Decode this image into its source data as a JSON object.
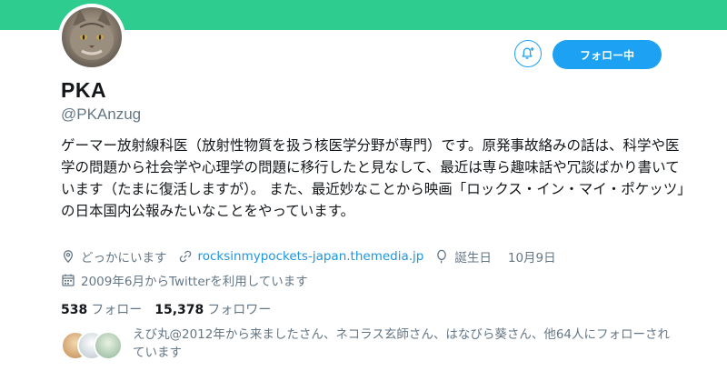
{
  "colors": {
    "banner": "#2ecc8f",
    "accent": "#1da1f2",
    "secondary_text": "#657786",
    "link": "#1b95e0"
  },
  "profile": {
    "name": "PKA",
    "handle": "@PKAnzug",
    "bio": "ゲーマー放射線科医（放射性物質を扱う核医学分野が専門）です。原発事故絡みの話は、科学や医学の問題から社会学や心理学の問題に移行したと見なして、最近は専ら趣味話や冗談ばかり書いています（たまに復活しますが）。 また、最近妙なことから映画「ロックス・イン・マイ・ポケッツ」の日本国内公報みたいなことをやっています。"
  },
  "actions": {
    "follow_label": "フォロー中",
    "notification_icon": "bell-plus-icon"
  },
  "meta": {
    "location": "どっかにいます",
    "location_icon": "location-pin-icon",
    "url": "rocksinmypockets-japan.themedia.jp",
    "url_icon": "link-icon",
    "birthday_label": "誕生日",
    "birthday_value": "10月9日",
    "birthday_icon": "balloon-icon",
    "joined": "2009年6月からTwitterを利用しています",
    "joined_icon": "calendar-icon"
  },
  "stats": {
    "following_count": "538",
    "following_label": "フォロー",
    "followers_count": "15,378",
    "followers_label": "フォロワー"
  },
  "followed_by": {
    "text": "えび丸@2012年から来ましたさん、ネコラス玄師さん、はなびら葵さん、他64人にフォローされています"
  }
}
